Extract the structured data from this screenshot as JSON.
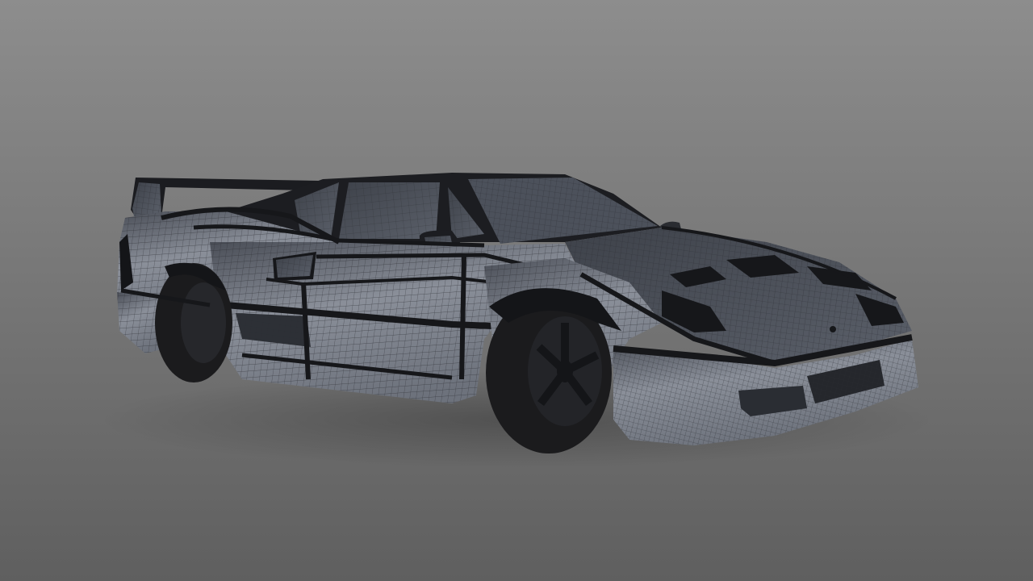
{
  "scene": {
    "subject": "wireframe-car",
    "background_top": "#8d8d8d",
    "background_bottom": "#5f5f5f",
    "surface_color": "#5b606a",
    "surface_highlight": "#8a8f99",
    "wire_color": "#2a2c31",
    "panel_line_color": "#16171a",
    "tire_color": "#1b1b1d"
  }
}
